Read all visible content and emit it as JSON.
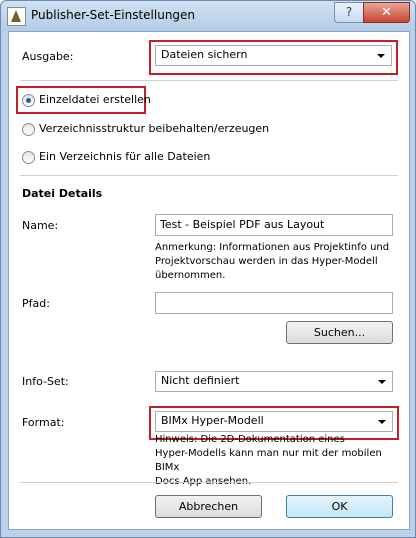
{
  "window": {
    "title": "Publisher-Set-Einstellungen",
    "help_label": "?",
    "close_label": "✕"
  },
  "ausgabe": {
    "label": "Ausgabe:",
    "value": "Dateien sichern"
  },
  "radios": [
    {
      "label": "Einzeldatei erstellen",
      "selected": true
    },
    {
      "label": "Verzeichnisstruktur beibehalten/erzeugen",
      "selected": false
    },
    {
      "label": "Ein Verzeichnis für alle Dateien",
      "selected": false
    }
  ],
  "details": {
    "heading": "Datei Details",
    "name_label": "Name:",
    "name_value": "Test - Beispiel PDF aus Layout",
    "name_note_1": "Anmerkung: Informationen aus Projektinfo und",
    "name_note_2": "Projektvorschau werden in das Hyper-Modell",
    "name_note_3": "übernommen.",
    "path_label": "Pfad:",
    "path_value": "",
    "search_button": "Suchen...",
    "infoset_label": "Info-Set:",
    "infoset_value": "Nicht definiert",
    "format_label": "Format:",
    "format_value": "BIMx Hyper-Modell",
    "format_note_1": "Hinweis: Die 2D-Dokumentation eines",
    "format_note_2": "Hyper-Modells kann man nur mit der mobilen BIMx",
    "format_note_3": "Docs App ansehen."
  },
  "footer": {
    "cancel_label": "Abbrechen",
    "ok_label": "OK"
  }
}
